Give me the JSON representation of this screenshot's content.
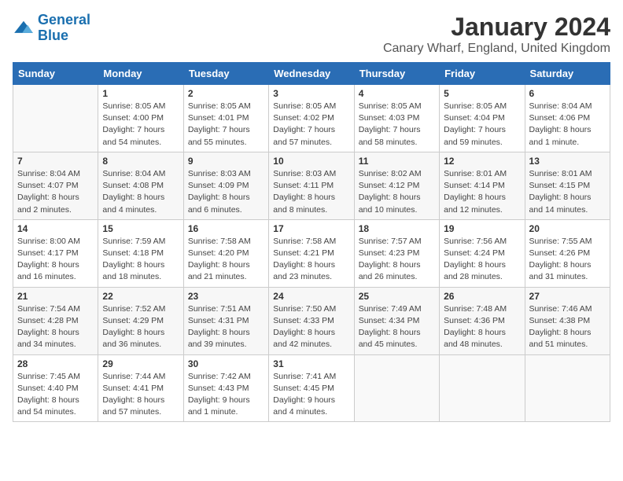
{
  "logo": {
    "line1": "General",
    "line2": "Blue"
  },
  "title": "January 2024",
  "subtitle": "Canary Wharf, England, United Kingdom",
  "weekdays": [
    "Sunday",
    "Monday",
    "Tuesday",
    "Wednesday",
    "Thursday",
    "Friday",
    "Saturday"
  ],
  "weeks": [
    [
      {
        "day": "",
        "info": ""
      },
      {
        "day": "1",
        "info": "Sunrise: 8:05 AM\nSunset: 4:00 PM\nDaylight: 7 hours\nand 54 minutes."
      },
      {
        "day": "2",
        "info": "Sunrise: 8:05 AM\nSunset: 4:01 PM\nDaylight: 7 hours\nand 55 minutes."
      },
      {
        "day": "3",
        "info": "Sunrise: 8:05 AM\nSunset: 4:02 PM\nDaylight: 7 hours\nand 57 minutes."
      },
      {
        "day": "4",
        "info": "Sunrise: 8:05 AM\nSunset: 4:03 PM\nDaylight: 7 hours\nand 58 minutes."
      },
      {
        "day": "5",
        "info": "Sunrise: 8:05 AM\nSunset: 4:04 PM\nDaylight: 7 hours\nand 59 minutes."
      },
      {
        "day": "6",
        "info": "Sunrise: 8:04 AM\nSunset: 4:06 PM\nDaylight: 8 hours\nand 1 minute."
      }
    ],
    [
      {
        "day": "7",
        "info": "Sunrise: 8:04 AM\nSunset: 4:07 PM\nDaylight: 8 hours\nand 2 minutes."
      },
      {
        "day": "8",
        "info": "Sunrise: 8:04 AM\nSunset: 4:08 PM\nDaylight: 8 hours\nand 4 minutes."
      },
      {
        "day": "9",
        "info": "Sunrise: 8:03 AM\nSunset: 4:09 PM\nDaylight: 8 hours\nand 6 minutes."
      },
      {
        "day": "10",
        "info": "Sunrise: 8:03 AM\nSunset: 4:11 PM\nDaylight: 8 hours\nand 8 minutes."
      },
      {
        "day": "11",
        "info": "Sunrise: 8:02 AM\nSunset: 4:12 PM\nDaylight: 8 hours\nand 10 minutes."
      },
      {
        "day": "12",
        "info": "Sunrise: 8:01 AM\nSunset: 4:14 PM\nDaylight: 8 hours\nand 12 minutes."
      },
      {
        "day": "13",
        "info": "Sunrise: 8:01 AM\nSunset: 4:15 PM\nDaylight: 8 hours\nand 14 minutes."
      }
    ],
    [
      {
        "day": "14",
        "info": "Sunrise: 8:00 AM\nSunset: 4:17 PM\nDaylight: 8 hours\nand 16 minutes."
      },
      {
        "day": "15",
        "info": "Sunrise: 7:59 AM\nSunset: 4:18 PM\nDaylight: 8 hours\nand 18 minutes."
      },
      {
        "day": "16",
        "info": "Sunrise: 7:58 AM\nSunset: 4:20 PM\nDaylight: 8 hours\nand 21 minutes."
      },
      {
        "day": "17",
        "info": "Sunrise: 7:58 AM\nSunset: 4:21 PM\nDaylight: 8 hours\nand 23 minutes."
      },
      {
        "day": "18",
        "info": "Sunrise: 7:57 AM\nSunset: 4:23 PM\nDaylight: 8 hours\nand 26 minutes."
      },
      {
        "day": "19",
        "info": "Sunrise: 7:56 AM\nSunset: 4:24 PM\nDaylight: 8 hours\nand 28 minutes."
      },
      {
        "day": "20",
        "info": "Sunrise: 7:55 AM\nSunset: 4:26 PM\nDaylight: 8 hours\nand 31 minutes."
      }
    ],
    [
      {
        "day": "21",
        "info": "Sunrise: 7:54 AM\nSunset: 4:28 PM\nDaylight: 8 hours\nand 34 minutes."
      },
      {
        "day": "22",
        "info": "Sunrise: 7:52 AM\nSunset: 4:29 PM\nDaylight: 8 hours\nand 36 minutes."
      },
      {
        "day": "23",
        "info": "Sunrise: 7:51 AM\nSunset: 4:31 PM\nDaylight: 8 hours\nand 39 minutes."
      },
      {
        "day": "24",
        "info": "Sunrise: 7:50 AM\nSunset: 4:33 PM\nDaylight: 8 hours\nand 42 minutes."
      },
      {
        "day": "25",
        "info": "Sunrise: 7:49 AM\nSunset: 4:34 PM\nDaylight: 8 hours\nand 45 minutes."
      },
      {
        "day": "26",
        "info": "Sunrise: 7:48 AM\nSunset: 4:36 PM\nDaylight: 8 hours\nand 48 minutes."
      },
      {
        "day": "27",
        "info": "Sunrise: 7:46 AM\nSunset: 4:38 PM\nDaylight: 8 hours\nand 51 minutes."
      }
    ],
    [
      {
        "day": "28",
        "info": "Sunrise: 7:45 AM\nSunset: 4:40 PM\nDaylight: 8 hours\nand 54 minutes."
      },
      {
        "day": "29",
        "info": "Sunrise: 7:44 AM\nSunset: 4:41 PM\nDaylight: 8 hours\nand 57 minutes."
      },
      {
        "day": "30",
        "info": "Sunrise: 7:42 AM\nSunset: 4:43 PM\nDaylight: 9 hours\nand 1 minute."
      },
      {
        "day": "31",
        "info": "Sunrise: 7:41 AM\nSunset: 4:45 PM\nDaylight: 9 hours\nand 4 minutes."
      },
      {
        "day": "",
        "info": ""
      },
      {
        "day": "",
        "info": ""
      },
      {
        "day": "",
        "info": ""
      }
    ]
  ]
}
